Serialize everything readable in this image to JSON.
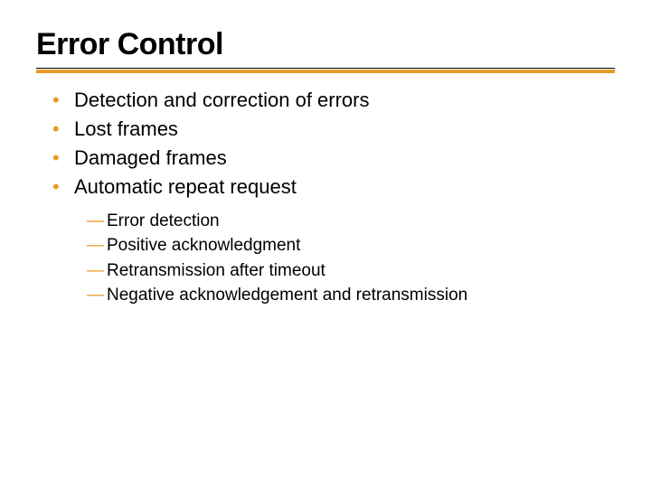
{
  "title": "Error Control",
  "bullets": [
    "Detection and correction of errors",
    "Lost frames",
    "Damaged frames",
    "Automatic repeat request"
  ],
  "sub": [
    "Error detection",
    "Positive acknowledgment",
    "Retransmission after timeout",
    "Negative acknowledgement and retransmission"
  ],
  "colors": {
    "accent": "#e99b26"
  }
}
